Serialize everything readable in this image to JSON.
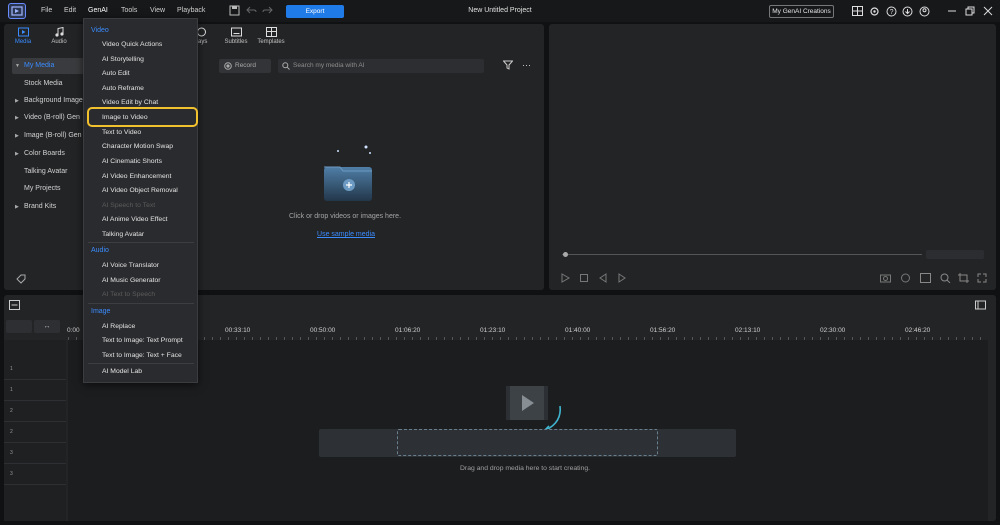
{
  "menu_bar": {
    "file": "File",
    "edit": "Edit",
    "genai": "GenAI",
    "tools": "Tools",
    "view": "View",
    "playback": "Playback"
  },
  "toolbar": {
    "export_label": "Export",
    "project_title": "New Untitled Project",
    "my_genai_label": "My GenAI Creations"
  },
  "library": {
    "tabs": [
      {
        "label": "Media"
      },
      {
        "label": "Audio"
      },
      {
        "label": "rlays"
      },
      {
        "label": "Subtitles"
      },
      {
        "label": "Templates"
      }
    ],
    "sidebar": [
      {
        "label": "My Media"
      },
      {
        "label": "Stock Media"
      },
      {
        "label": "Background Image"
      },
      {
        "label": "Video (B-roll) Gen"
      },
      {
        "label": "Image (B-roll) Gen"
      },
      {
        "label": "Color Boards"
      },
      {
        "label": "Talking Avatar"
      },
      {
        "label": "My Projects"
      },
      {
        "label": "Brand Kits"
      }
    ],
    "record_label": "Record",
    "search_placeholder": "Search my media with AI",
    "drop_text": "Click or drop videos or images here.",
    "sample_link": "Use sample media"
  },
  "genai_menu": {
    "video_header": "Video",
    "video_items": [
      {
        "label": "Video Quick Actions",
        "enabled": true
      },
      {
        "label": "AI Storytelling",
        "enabled": true
      },
      {
        "label": "Auto Edit",
        "enabled": true
      },
      {
        "label": "Auto Reframe",
        "enabled": true
      },
      {
        "label": "Video Edit by Chat",
        "enabled": true
      },
      {
        "label": "Image to Video",
        "enabled": true
      },
      {
        "label": "Text to Video",
        "enabled": true
      },
      {
        "label": "Character Motion Swap",
        "enabled": true
      },
      {
        "label": "AI Cinematic Shorts",
        "enabled": true
      },
      {
        "label": "AI Video Enhancement",
        "enabled": true
      },
      {
        "label": "AI Video Object Removal",
        "enabled": true
      },
      {
        "label": "AI Speech to Text",
        "enabled": false
      },
      {
        "label": "AI Anime Video Effect",
        "enabled": true
      },
      {
        "label": "Talking Avatar",
        "enabled": true
      }
    ],
    "audio_header": "Audio",
    "audio_items": [
      {
        "label": "AI Voice Translator",
        "enabled": true
      },
      {
        "label": "AI Music Generator",
        "enabled": true
      },
      {
        "label": "AI Text to Speech",
        "enabled": false
      }
    ],
    "image_header": "Image",
    "image_items": [
      {
        "label": "AI Replace",
        "enabled": true
      },
      {
        "label": "Text to Image: Text Prompt",
        "enabled": true
      },
      {
        "label": "Text to Image: Text + Face",
        "enabled": true
      }
    ],
    "lab_item": "AI Model Lab",
    "highlighted_item": "Image to Video"
  },
  "timeline": {
    "ruler": [
      "0:00",
      "00:33:10",
      "00:50:00",
      "01:06:20",
      "01:23:10",
      "01:40:00",
      "01:56:20",
      "02:13:10",
      "02:30:00",
      "02:46:20"
    ],
    "track_numbers": [
      "1",
      "1",
      "2",
      "2",
      "3",
      "3"
    ],
    "hint": "Drag and drop media here to start creating."
  },
  "colors": {
    "accent": "#3a8cff",
    "export": "#1f7be8",
    "highlight_ring": "#f2c12e",
    "background": "#101113",
    "panel": "#232426"
  }
}
